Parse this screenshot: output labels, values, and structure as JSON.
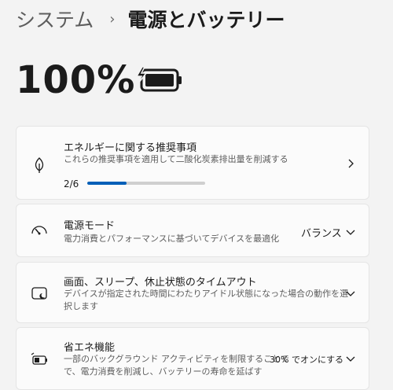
{
  "breadcrumb": {
    "parent": "システム",
    "separator": "›",
    "current": "電源とバッテリー"
  },
  "battery": {
    "percent_text": "100%",
    "icon": "battery-charging-icon",
    "level": 1.0
  },
  "cards": [
    {
      "title": "エネルギーに関する推奨事項",
      "desc": "これらの推奨事項を適用して二酸化炭素排出量を削減する",
      "icon": "leaf-icon",
      "progress_text": "2/6",
      "progress_fraction": 0.333,
      "chevron": "chevron-right-icon"
    },
    {
      "title": "電源モード",
      "desc": "電力消費とパフォーマンスに基づいてデバイスを最適化",
      "icon": "gauge-icon",
      "value": "バランス",
      "chevron": "chevron-down-icon"
    },
    {
      "title": "画面、スリープ、休止状態のタイムアウト",
      "desc_lines": [
        "デバイスが指定された時間にわたりアイドル状態になった場合の動作を選",
        "択します"
      ],
      "icon": "screen-sleep-icon",
      "chevron": "chevron-down-icon"
    },
    {
      "title": "省エネ機能",
      "desc_lines": [
        "一部のバックグラウンド アクティビティを制限することで",
        "で、電力消費を削減し、バッテリーの寿命を延ばす"
      ],
      "icon": "battery-saver-icon",
      "value": "30% でオンにする",
      "chevron": "chevron-down-icon"
    }
  ],
  "colors": {
    "accent": "#005fb8",
    "background": "#f3f3f3",
    "card": "#fbfbfb"
  }
}
